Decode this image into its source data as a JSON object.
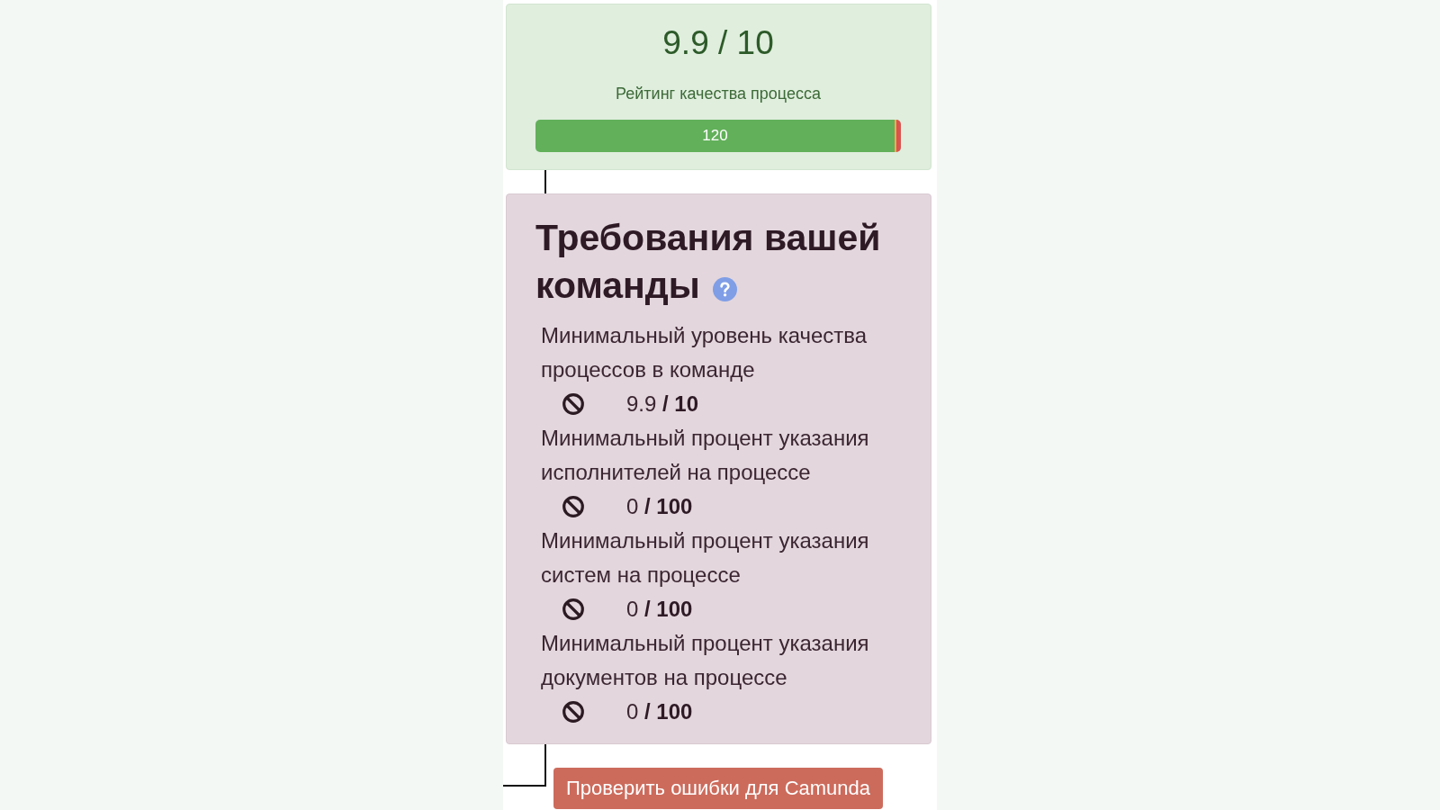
{
  "rating_card": {
    "score": "9.9 / 10",
    "subtitle": "Рейтинг качества процесса",
    "progress": {
      "segments": [
        {
          "label": "120",
          "level": 0.983,
          "color": "#62b05a"
        },
        {
          "level": 0.005,
          "color": "#f0ad4e"
        },
        {
          "level": 0.012,
          "color": "#d9534f"
        }
      ]
    }
  },
  "requirements_card": {
    "title_lines": [
      "Требования вашей",
      "команды"
    ],
    "requirements": [
      {
        "label": "Минимальный уровень качества процессов в команде",
        "value": "9.9 **/ 10**"
      },
      {
        "label": "Минимальный процент указания исполнителей на процессе",
        "value": "0 **/ 100**"
      },
      {
        "label": "Минимальный процент указания систем на процессе",
        "value": "0 **/ 100**"
      },
      {
        "label": "Минимальный процент указания документов на процессе",
        "value": "0 **/ 100**"
      }
    ]
  },
  "check_button": "Проверить ошибки для Camunda"
}
